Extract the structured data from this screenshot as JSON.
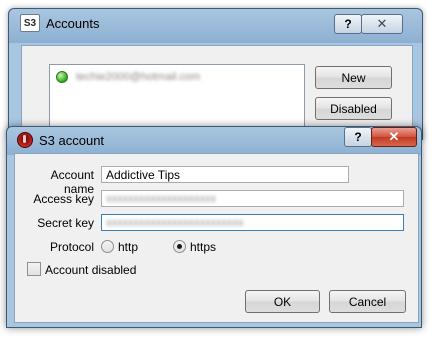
{
  "accounts_window": {
    "logo": "S3",
    "title": "Accounts",
    "help_glyph": "?",
    "close_glyph": "✕",
    "account_email": "techie2000@hotmail.com",
    "new_label": "New",
    "disabled_label": "Disabled"
  },
  "s3_dialog": {
    "title": "S3 account",
    "help_glyph": "?",
    "close_glyph": "✕",
    "account_name_label": "Account name",
    "account_name_value": "Addictive Tips",
    "access_key_label": "Access key",
    "access_key_value": "xxxxxxxxxxxxxxxxxxxx",
    "secret_key_label": "Secret key",
    "secret_key_value": "xxxxxxxxxxxxxxxxxxxxxxxxx",
    "protocol_label": "Protocol",
    "protocol_options": [
      "http",
      "https"
    ],
    "protocol_selected": "https",
    "account_disabled_label": "Account disabled",
    "account_disabled_checked": false,
    "ok_label": "OK",
    "cancel_label": "Cancel"
  }
}
